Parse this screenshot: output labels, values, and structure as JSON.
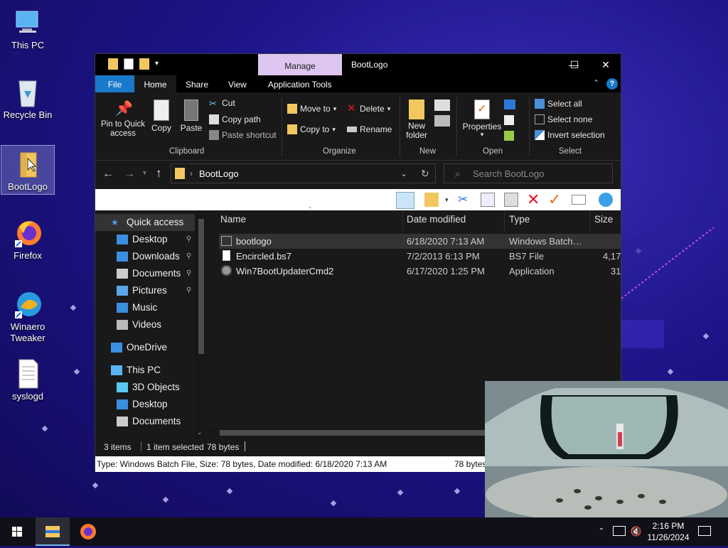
{
  "desktop": {
    "icons": [
      {
        "label": "This PC",
        "icon": "this-pc-icon"
      },
      {
        "label": "Recycle Bin",
        "icon": "recycle-bin-icon"
      },
      {
        "label": "BootLogo",
        "icon": "folder-icon"
      },
      {
        "label": "Firefox",
        "icon": "firefox-icon"
      },
      {
        "label": "Winaero\nTweaker",
        "icon": "winaero-tweaker-icon"
      },
      {
        "label": "syslogd",
        "icon": "text-file-icon"
      }
    ]
  },
  "window": {
    "title": "BootLogo",
    "context_tab": "Manage",
    "controls": {
      "minimize": "—",
      "maximize": "☐",
      "close": "✕"
    },
    "tabs": [
      "File",
      "Home",
      "Share",
      "View",
      "Application Tools"
    ],
    "help": "?"
  },
  "ribbon": {
    "clipboard": {
      "pin": "Pin to Quick\naccess",
      "copy": "Copy",
      "paste": "Paste",
      "cut": "Cut",
      "copy_path": "Copy path",
      "paste_shortcut": "Paste shortcut",
      "label": "Clipboard"
    },
    "organize": {
      "move_to": "Move to",
      "copy_to": "Copy to",
      "delete": "Delete",
      "rename": "Rename",
      "label": "Organize"
    },
    "new": {
      "new_folder": "New\nfolder",
      "label": "New"
    },
    "open": {
      "properties": "Properties",
      "label": "Open"
    },
    "select": {
      "select_all": "Select all",
      "select_none": "Select none",
      "invert": "Invert selection",
      "label": "Select"
    }
  },
  "address": {
    "path": "BootLogo",
    "search_placeholder": "Search BootLogo"
  },
  "nav": {
    "items": [
      {
        "label": "Quick access",
        "icon": "star-icon",
        "indent": 0,
        "pinned": false,
        "selected": true
      },
      {
        "label": "Desktop",
        "icon": "desktop-icon",
        "indent": 1,
        "pinned": true
      },
      {
        "label": "Downloads",
        "icon": "download-icon",
        "indent": 1,
        "pinned": true
      },
      {
        "label": "Documents",
        "icon": "documents-icon",
        "indent": 1,
        "pinned": true
      },
      {
        "label": "Pictures",
        "icon": "pictures-icon",
        "indent": 1,
        "pinned": true
      },
      {
        "label": "Music",
        "icon": "music-icon",
        "indent": 1,
        "pinned": false
      },
      {
        "label": "Videos",
        "icon": "videos-icon",
        "indent": 1,
        "pinned": false
      },
      {
        "label": "OneDrive",
        "icon": "onedrive-icon",
        "indent": 0,
        "pinned": false
      },
      {
        "label": "This PC",
        "icon": "this-pc-icon",
        "indent": 0,
        "pinned": false
      },
      {
        "label": "3D Objects",
        "icon": "3d-objects-icon",
        "indent": 1,
        "pinned": false
      },
      {
        "label": "Desktop",
        "icon": "desktop-icon",
        "indent": 1,
        "pinned": false
      },
      {
        "label": "Documents",
        "icon": "documents-icon",
        "indent": 1,
        "pinned": false
      }
    ]
  },
  "files": {
    "columns": [
      "Name",
      "Date modified",
      "Type",
      "Size"
    ],
    "rows": [
      {
        "name": "bootlogo",
        "date": "6/18/2020 7:13 AM",
        "type": "Windows Batch…",
        "size": "",
        "selected": true
      },
      {
        "name": "Encircled.bs7",
        "date": "7/2/2013 6:13 PM",
        "type": "BS7 File",
        "size": "4,17",
        "selected": false
      },
      {
        "name": "Win7BootUpdaterCmd2",
        "date": "6/17/2020 1:25 PM",
        "type": "Application",
        "size": "31",
        "selected": false
      }
    ]
  },
  "status": {
    "items": "3 items",
    "selected": "1 item selected",
    "size": "78 bytes",
    "info": "Type: Windows Batch File, Size: 78 bytes, Date modified: 6/18/2020 7:13 AM",
    "info_size": "78 bytes"
  },
  "taskbar": {
    "time": "2:16 PM",
    "date": "11/26/2024"
  }
}
